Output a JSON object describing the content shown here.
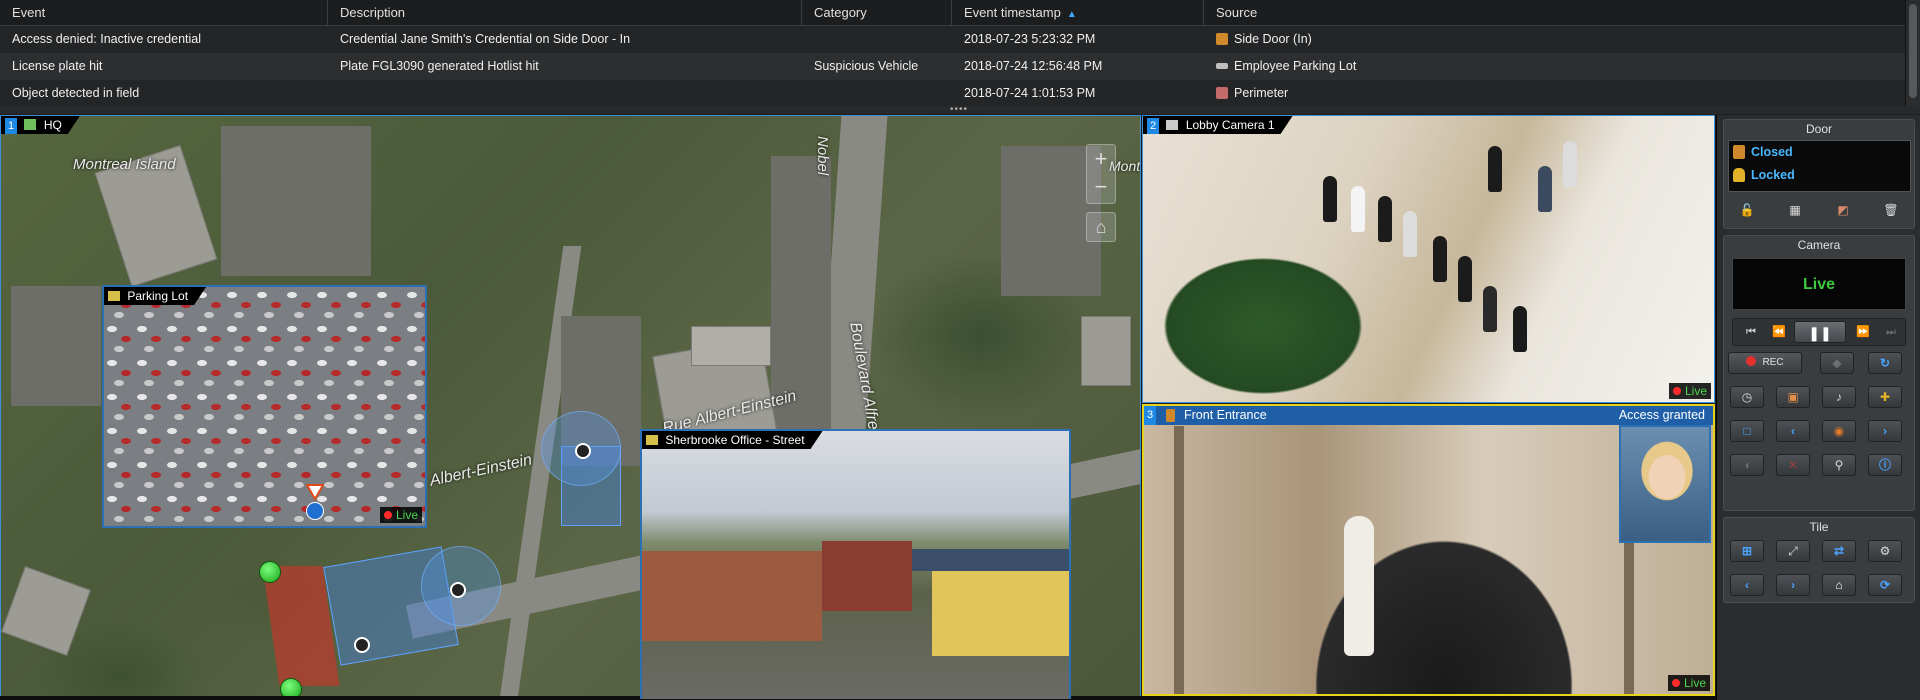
{
  "events": {
    "columns": [
      {
        "label": "Event"
      },
      {
        "label": "Description"
      },
      {
        "label": "Category"
      },
      {
        "label": "Event timestamp",
        "sorted": "ascending"
      },
      {
        "label": "Source"
      }
    ],
    "rows": [
      {
        "event": "Access denied: Inactive credential",
        "description": "Credential Jane Smith's Credential on Side Door - In",
        "category": "",
        "timestamp": "2018-07-23 5:23:32 PM",
        "source": "Side Door (In)",
        "source_icon": "door-icon"
      },
      {
        "event": "License plate hit",
        "description": "Plate FGL3090 generated Hotlist hit",
        "category": "Suspicious Vehicle",
        "timestamp": "2018-07-24 12:56:48 PM",
        "source": "Employee Parking Lot",
        "source_icon": "lpr-camera-icon"
      },
      {
        "event": "Object detected in field",
        "description": "",
        "category": "",
        "timestamp": "2018-07-24 1:01:53 PM",
        "source": "Perimeter",
        "source_icon": "zone-icon"
      }
    ]
  },
  "tiles": {
    "map": {
      "number": "1",
      "title": "HQ",
      "labels": {
        "island": "Montreal Island",
        "nobel": "Nobel",
        "boulevard": "Boulevard Alfre",
        "albert_einstein_east": "Rue Albert-Einstein",
        "albert_einstein_west": "Albert-Einstein",
        "montre": "Montre"
      },
      "zoom_in": "+",
      "zoom_out": "−",
      "home": "⌂",
      "popups": [
        {
          "title": "Parking Lot",
          "live": "Live"
        },
        {
          "title": "Sherbrooke Office - Street"
        }
      ]
    },
    "lobby": {
      "number": "2",
      "title": "Lobby Camera 1",
      "live": "Live"
    },
    "entrance": {
      "number": "3",
      "title": "Front Entrance",
      "event_label": "Access granted",
      "live": "Live"
    }
  },
  "dashboard": {
    "door": {
      "title": "Door",
      "status": [
        "Closed",
        "Locked"
      ],
      "actions": [
        "unlock-icon",
        "schedule-icon",
        "eraser-icon",
        "trash-icon"
      ]
    },
    "camera": {
      "title": "Camera",
      "state": "Live",
      "transport": [
        "⏮",
        "⏪",
        "❚❚",
        "⏩",
        "⏭"
      ],
      "rec_label": "REC"
    },
    "tile": {
      "title": "Tile"
    }
  },
  "colors": {
    "accent": "#1e88e5",
    "live_green": "#3ec93e",
    "door_status_blue": "#49b8ff",
    "entrance_border": "#e5d21b",
    "rec_red": "#e53030"
  }
}
